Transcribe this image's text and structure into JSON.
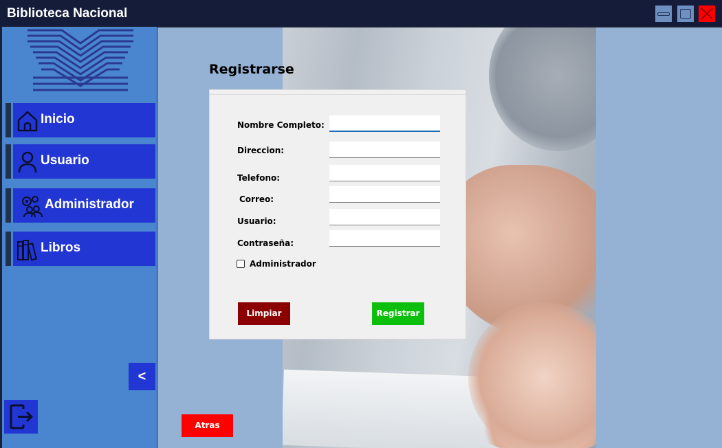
{
  "window": {
    "title": "Biblioteca Nacional",
    "controls": [
      "minimize-icon",
      "maximize-icon",
      "close-icon"
    ]
  },
  "sidebar": {
    "logo": "library-logo",
    "items": [
      {
        "label": "Inicio",
        "icon": "home-icon"
      },
      {
        "label": "Usuario",
        "icon": "user-icon"
      },
      {
        "label": "Administrador",
        "icon": "admin-gears-icon"
      },
      {
        "label": "Libros",
        "icon": "books-icon"
      }
    ],
    "collapse_label": "<",
    "logout_icon": "logout-icon",
    "accent": "#2236d4",
    "background": "#4a86d0"
  },
  "form": {
    "title": "Registrarse",
    "fields": [
      {
        "label": "Nombre Completo:",
        "value": "",
        "focused": true
      },
      {
        "label": "Direccion:",
        "value": ""
      },
      {
        "label": "Telefono:",
        "value": ""
      },
      {
        "label": "Correo:",
        "value": ""
      },
      {
        "label": "Usuario:",
        "value": ""
      },
      {
        "label": "Contraseña:",
        "value": ""
      }
    ],
    "admin_checkbox": {
      "label": "Administrador",
      "checked": false
    },
    "clear_button": "Limpiar",
    "register_button": "Registrar",
    "back_button": "Atras",
    "colors": {
      "clear": "#8b0000",
      "register": "#0cbf0c",
      "back": "#ff0000"
    }
  }
}
